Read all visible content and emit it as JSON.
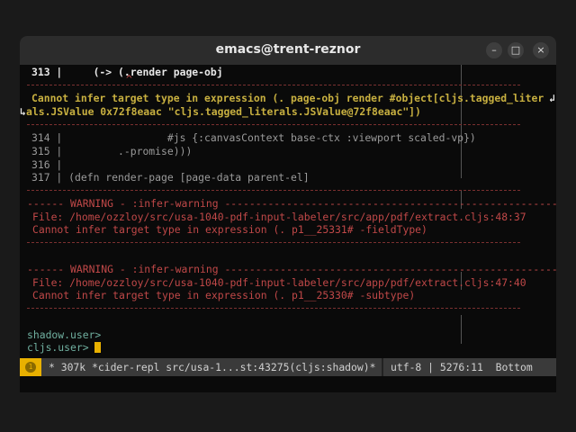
{
  "window": {
    "title": "emacs@trent-reznor",
    "minimize": "–",
    "maximize": "□",
    "close": "×"
  },
  "buffer": {
    "line313": "313 |     (-> (.render page-obj",
    "caret": "^",
    "error1a": "Cannot infer target type in expression (. page-obj render #object[cljs.tagged_liter",
    "wrap_right": "↲",
    "wrap_left": "↳",
    "error1b": "als.JSValue 0x72f8eaac \"cljs.tagged_literals.JSValue@72f8eaac\"])",
    "line314": "314 |                 #js {:canvasContext base-ctx :viewport scaled-vp})",
    "line315": "315 |         .-promise)))",
    "line316": "316 |",
    "line317": "317 | (defn render-page [page-data parent-el]",
    "warnings": [
      {
        "header": "------ WARNING - :infer-warning ------------------------------------------------------",
        "file": "File: /home/ozzloy/src/usa-1040-pdf-input-labeler/src/app/pdf/extract.cljs:48:37",
        "message": "Cannot infer target type in expression (. p1__25331# -fieldType)"
      },
      {
        "header": "------ WARNING - :infer-warning ------------------------------------------------------",
        "file": "File: /home/ozzloy/src/usa-1040-pdf-input-labeler/src/app/pdf/extract.cljs:47:40",
        "message": "Cannot infer target type in expression (. p1__25330# -subtype)"
      }
    ],
    "prompt1": "shadow.user>",
    "prompt2": "cljs.user> "
  },
  "modeline": {
    "badge": "1",
    "left": "* 307k *cider-repl src/usa-1...st:43275(cljs:shadow)*",
    "right": "utf-8 | 5276:11  Bottom"
  }
}
